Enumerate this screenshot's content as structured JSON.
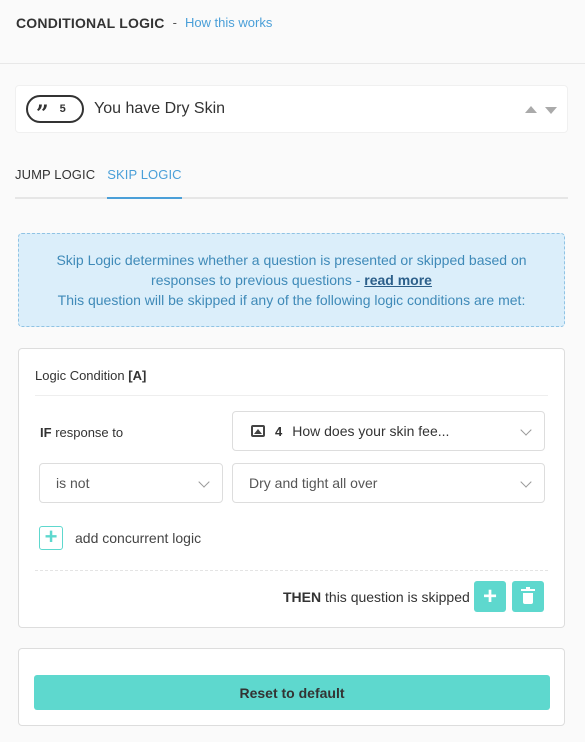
{
  "header": {
    "title": "CONDITIONAL LOGIC",
    "separator": "-",
    "link": "How this works"
  },
  "question": {
    "icon": "quote-icon",
    "number": "5",
    "title": "You have Dry Skin"
  },
  "tabs": [
    {
      "label": "JUMP LOGIC",
      "active": false
    },
    {
      "label": "SKIP LOGIC",
      "active": true
    }
  ],
  "info": {
    "line1": "Skip Logic determines whether a question is presented or skipped based on",
    "line2_prefix": "responses to previous questions -",
    "read_more": "read more",
    "line3": "This question will be skipped if any of the following logic conditions are met:"
  },
  "condition": {
    "label": "Logic Condition",
    "id": "[A]",
    "if_keyword": "IF",
    "if_text": "response to",
    "question_select": {
      "icon": "image-icon",
      "number": "4",
      "text": "How does your skin fee..."
    },
    "operator": "is not",
    "value": "Dry and tight all over",
    "add_concurrent": "add concurrent logic",
    "then_keyword": "THEN",
    "then_text": "this question is skipped"
  },
  "reset_label": "Reset to default",
  "colors": {
    "accent": "#5ed8ce",
    "link": "#4a9fd8",
    "info_bg": "#dbeefa"
  }
}
